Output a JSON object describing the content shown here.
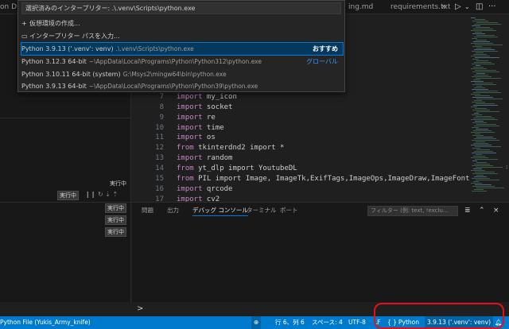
{
  "tabs": {
    "partial_left": "on D",
    "partial_mid": "ing.md",
    "requirements": "requirements.txt",
    "close": "×"
  },
  "toolbar": {
    "run_icon": "play-icon",
    "chevron_icon": "chevron-down-icon",
    "split_icon": "split-editor-icon",
    "more": "···"
  },
  "quickpick": {
    "input_value": "選択済みのインタープリター: .\\.venv\\Scripts\\python.exe",
    "create_env": "仮想環境の作成...",
    "enter_path": "インタープリター パスを入力...",
    "items": [
      {
        "name": "Python 3.9.13 ('.venv': venv)",
        "path": ".\\.venv\\Scripts\\python.exe",
        "tag": "おすすめ"
      },
      {
        "name": "Python 3.12.3 64-bit",
        "path": "~\\AppData\\Local\\Programs\\Python\\Python312\\python.exe",
        "tag": "グローバル"
      },
      {
        "name": "Python 3.10.11 64-bit (system)",
        "path": "G:\\Msys2\\mingw64\\bin\\python.exe",
        "tag": ""
      },
      {
        "name": "Python 3.9.13 64-bit",
        "path": "~\\AppData\\Local\\Programs\\Python\\Python39\\python.exe",
        "tag": ""
      }
    ]
  },
  "leftpanel": {
    "running_label": "実行中",
    "controls": "❙❙  ↻  ⇣  ⇡"
  },
  "editor": {
    "lines": [
      {
        "n": "7",
        "kw": "import",
        "rest": " my_icon"
      },
      {
        "n": "8",
        "kw": "import",
        "rest": " socket"
      },
      {
        "n": "9",
        "kw": "import",
        "rest": " re"
      },
      {
        "n": "10",
        "kw": "import",
        "rest": " time"
      },
      {
        "n": "11",
        "kw": "import",
        "rest": " os"
      },
      {
        "n": "12",
        "kw": "from",
        "rest": " tkinterdnd2 import *"
      },
      {
        "n": "13",
        "kw": "import",
        "rest": " random"
      },
      {
        "n": "14",
        "kw": "from",
        "rest": " yt_dlp import YoutubeDL"
      },
      {
        "n": "15",
        "kw": "from",
        "rest": " PIL import Image, ImageTk,ExifTags,ImageOps,ImageDraw,ImageFont"
      },
      {
        "n": "16",
        "kw": "import",
        "rest": " qrcode"
      },
      {
        "n": "17",
        "kw": "import",
        "rest": " cv2"
      }
    ]
  },
  "panel": {
    "tabs": [
      "問題",
      "出力",
      "デバッグ コンソール",
      "ターミナル",
      "ポート"
    ],
    "active_tab": "デバッグ コンソール",
    "filter_placeholder": "フィルター (例: text, !exclu...",
    "prompt": ">"
  },
  "statusbar": {
    "left": "Python File (Yukis_Army_knife)",
    "position": "行 6、列 6",
    "spaces": "スペース: 4",
    "encoding": "UTF-8",
    "eol": "LF",
    "language": "Python",
    "interpreter": "3.9.13 ('.venv': venv)"
  },
  "colors": {
    "accent": "#0078d4",
    "statusbar": "#007acc",
    "annotation": "#e0131c"
  }
}
